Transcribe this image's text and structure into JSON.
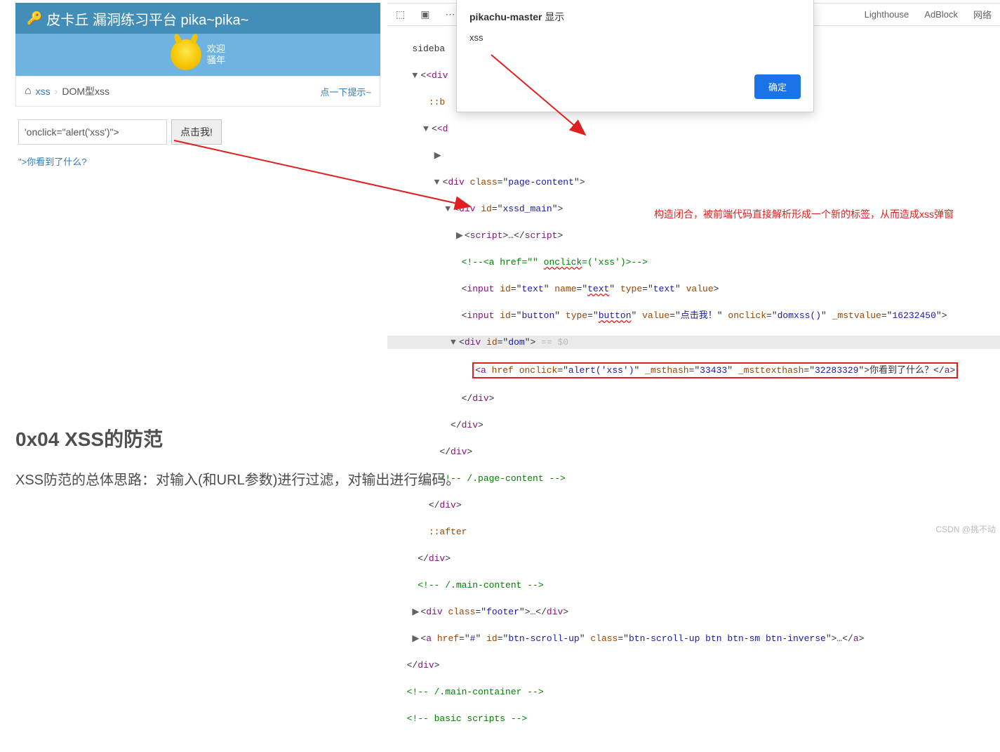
{
  "app": {
    "title": "皮卡丘 漏洞练习平台 pika~pika~",
    "welcome_line1": "欢迎",
    "welcome_line2": "骚年"
  },
  "breadcrumb": {
    "crumb1": "xss",
    "crumb2": "DOM型xss",
    "hint": "点一下提示~"
  },
  "form": {
    "input_value": "'onclick=\"alert('xss')\">",
    "button_label": "点击我!",
    "result_link": "\">你看到了什么?"
  },
  "devtools": {
    "tabs": {
      "lighthouse": "Lighthouse",
      "adblock": "AdBlock",
      "network": "网络"
    },
    "annotation": "构造闭合，被前端代码直接解析形成一个新的标签，从而造成xss弹窗",
    "code": {
      "l1": "sideba",
      "l2_pre": "<div",
      "l3": "::b",
      "l4": "<d",
      "l5_pre": "<div class=",
      "l5_val": "page-content",
      "l6_pre": "<div id=",
      "l6_val": "xssd_main",
      "l7": "<script>…</script",
      "l8a": "<!--<a href=\"\" ",
      "l8b": "onclick",
      "l8c": "('xss')>-->",
      "l9a": "<input id=",
      "l9b": "text",
      "l9c": " name=",
      "l9d": "text",
      "l9e": " type=",
      "l9f": "text",
      "l9g": " value>",
      "l10a": "<input id=",
      "l10b": "button",
      "l10c": " type=",
      "l10d": "button",
      "l10e": " value=",
      "l10f": "点击我！",
      "l10g": " onclick=",
      "l10h": "domxss()",
      "l10i": " _mstvalue=",
      "l10j": "16232450",
      "l10k": ">",
      "l11a": "<div id=",
      "l11b": "dom",
      "l11c": ">",
      "l11d": " == $0",
      "l12a": "<a href onclick=",
      "l12b": "alert('xss')",
      "l12c": " _msthash=",
      "l12d": "33433",
      "l12e": " _msttexthash=",
      "l12f": "32283329",
      "l12g": ">",
      "l12h": "你看到了什么？",
      "l12i": "</a>",
      "l13": "</div>",
      "l14": "</div>",
      "l15": "</div>",
      "l16": "<!-- /.page-content -->",
      "l17": "</div>",
      "l18": "::after",
      "l19": "</div>",
      "l20": "<!-- /.main-content -->",
      "l21a": "<div class=",
      "l21b": "footer",
      "l21c": ">…</div>",
      "l22a": "<a href=",
      "l22b": "#",
      "l22c": " id=",
      "l22d": "btn-scroll-up",
      "l22e": " class=",
      "l22f": "btn-scroll-up btn btn-sm btn-inverse",
      "l22g": ">…</a>",
      "l23": "</div>",
      "l24": "<!-- /.main-container -->",
      "l25": "<!-- basic scripts -->"
    }
  },
  "alert": {
    "title_origin": "pikachu-master",
    "title_suffix": "显示",
    "message": "xss",
    "ok": "确定"
  },
  "article": {
    "heading": "0x04 XSS的防范",
    "text": "XSS防范的总体思路：对输入(和URL参数)进行过滤，对输出进行编码。"
  },
  "watermark": "CSDN @挑不动"
}
